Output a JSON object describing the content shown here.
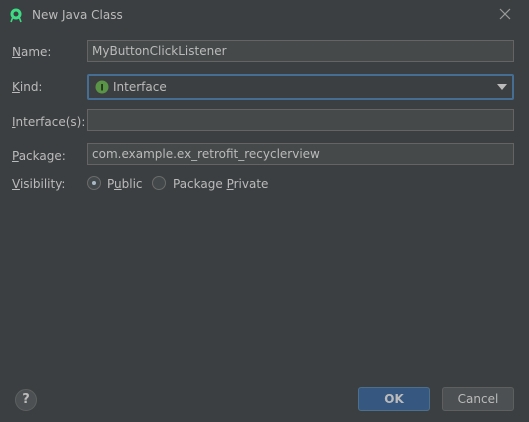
{
  "window": {
    "title": "New Java Class",
    "app_icon": "android-studio-icon",
    "close_icon": "close-icon"
  },
  "form": {
    "name": {
      "label": "Name:",
      "mnemonic": "N",
      "rest": "ame:",
      "value": "MyButtonClickListener"
    },
    "kind": {
      "label": "Kind:",
      "mnemonic": "K",
      "rest": "ind:",
      "value": "Interface",
      "icon": "interface-icon",
      "icon_letter": "I",
      "icon_color": "#5a9446"
    },
    "interfaces": {
      "label": "Interface(s):",
      "mnemonic": "I",
      "rest": "nterface(s):",
      "value": ""
    },
    "package": {
      "label": "Package:",
      "mnemonic": "P",
      "rest": "ackage:",
      "value": "com.example.ex_retrofit_recyclerview"
    },
    "visibility": {
      "label": "Visibility:",
      "mnemonic": "V",
      "rest": "isibility:",
      "options": [
        {
          "label": "Public",
          "pre": "P",
          "mnemonic": "u",
          "post": "blic",
          "selected": true
        },
        {
          "label": "Package Private",
          "pre": "Package ",
          "mnemonic": "P",
          "post": "rivate",
          "selected": false
        }
      ]
    }
  },
  "footer": {
    "help_icon": "help-icon",
    "help_glyph": "?",
    "ok_label": "OK",
    "cancel_label": "Cancel"
  },
  "colors": {
    "background": "#3c3f41",
    "field_background": "#45494a",
    "focus_border": "#466d94",
    "default_button": "#365880"
  }
}
